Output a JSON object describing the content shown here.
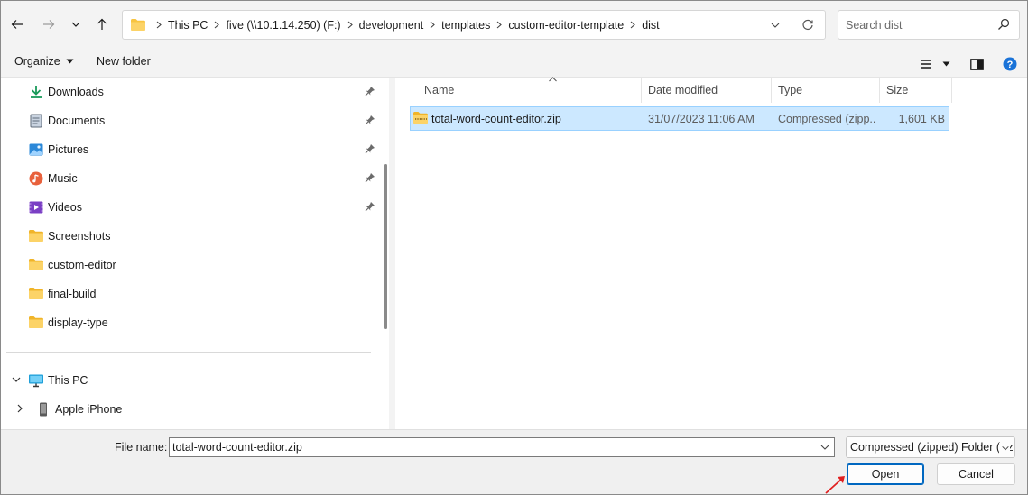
{
  "address": {
    "crumbs": [
      "This PC",
      "five (\\\\10.1.14.250) (F:)",
      "development",
      "templates",
      "custom-editor-template",
      "dist"
    ]
  },
  "search": {
    "placeholder": "Search dist"
  },
  "toolbar": {
    "organize_label": "Organize",
    "new_folder_label": "New folder"
  },
  "nav": {
    "quick_access": [
      {
        "label": "Downloads",
        "icon": "download-icon",
        "pinned": true
      },
      {
        "label": "Documents",
        "icon": "documents-icon",
        "pinned": true
      },
      {
        "label": "Pictures",
        "icon": "pictures-icon",
        "pinned": true
      },
      {
        "label": "Music",
        "icon": "music-icon",
        "pinned": true
      },
      {
        "label": "Videos",
        "icon": "videos-icon",
        "pinned": true
      },
      {
        "label": "Screenshots",
        "icon": "folder-icon",
        "pinned": false
      },
      {
        "label": "custom-editor",
        "icon": "folder-icon",
        "pinned": false
      },
      {
        "label": "final-build",
        "icon": "folder-icon",
        "pinned": false
      },
      {
        "label": "display-type",
        "icon": "folder-icon",
        "pinned": false
      }
    ],
    "this_pc_label": "This PC",
    "iphone_label": "Apple iPhone"
  },
  "columns": {
    "name": "Name",
    "date": "Date modified",
    "type": "Type",
    "size": "Size"
  },
  "files": [
    {
      "name": "total-word-count-editor.zip",
      "date": "31/07/2023 11:06 AM",
      "type": "Compressed (zipp...",
      "size": "1,601 KB",
      "selected": true
    }
  ],
  "footer": {
    "file_name_label": "File name:",
    "file_name_value": "total-word-count-editor.zip",
    "file_type_value": "Compressed (zipped) Folder (*.zip)",
    "open_label": "Open",
    "cancel_label": "Cancel"
  },
  "colors": {
    "accent": "#0067c0",
    "selection": "#cce8ff",
    "folder": "#f8c440",
    "annotation_arrow": "#e02020"
  }
}
